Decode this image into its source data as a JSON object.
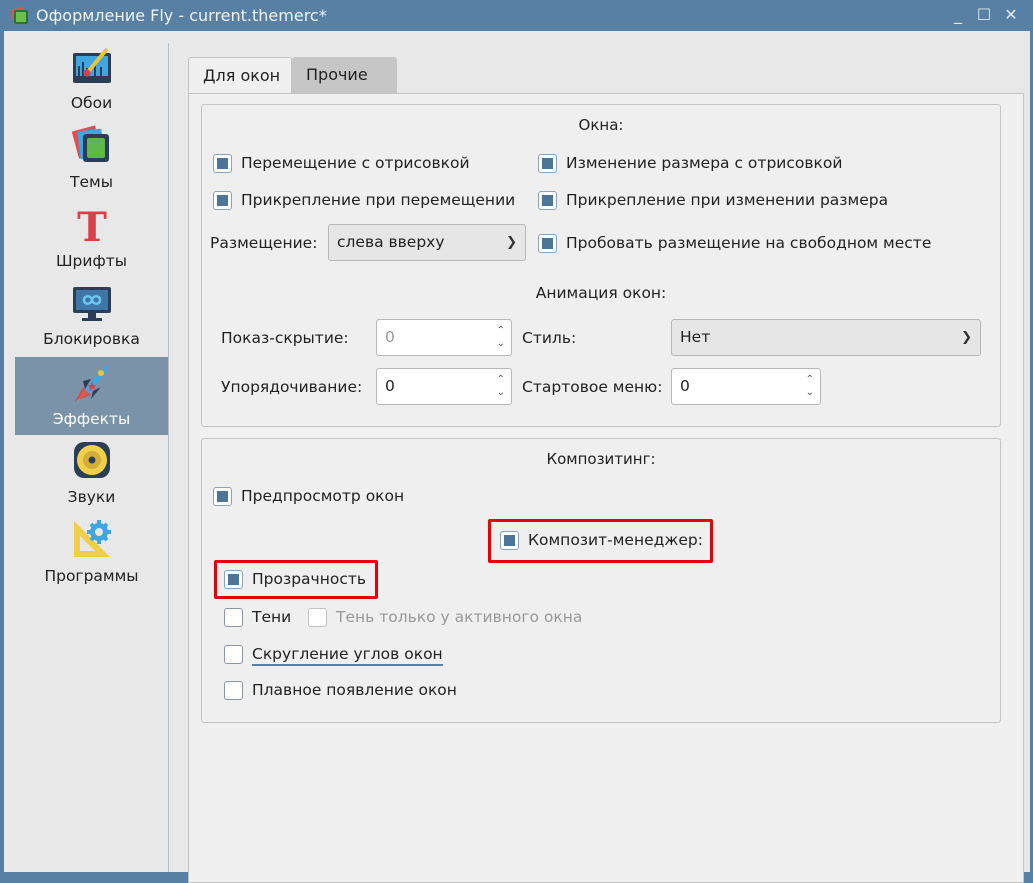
{
  "window": {
    "title": "Оформление Fly - current.themerc*",
    "controls": {
      "minimize": "_",
      "maximize": "☐",
      "close": "✕"
    }
  },
  "sidebar": {
    "items": [
      {
        "label": "Обои",
        "icon": "wallpaper-icon"
      },
      {
        "label": "Темы",
        "icon": "themes-icon"
      },
      {
        "label": "Шрифты",
        "icon": "fonts-icon"
      },
      {
        "label": "Блокировка",
        "icon": "lock-screen-icon"
      },
      {
        "label": "Эффекты",
        "icon": "rocket-icon",
        "selected": true
      },
      {
        "label": "Звуки",
        "icon": "speaker-icon"
      },
      {
        "label": "Программы",
        "icon": "programs-icon"
      }
    ]
  },
  "tabs": [
    {
      "label": "Для окон",
      "active": true
    },
    {
      "label": "Прочие",
      "active": false
    }
  ],
  "windows_group": {
    "title": "Окна:",
    "move_opaque": {
      "label": "Перемещение с отрисовкой",
      "checked": true
    },
    "resize_opaque": {
      "label": "Изменение размера с отрисовкой",
      "checked": true
    },
    "snap_move": {
      "label": "Прикрепление при перемещении",
      "checked": true
    },
    "snap_resize": {
      "label": "Прикрепление при изменении размера",
      "checked": true
    },
    "placement_label": "Размещение:",
    "placement_value": "слева вверху",
    "smart_placement": {
      "label": "Пробовать размещение на свободном месте",
      "checked": true
    },
    "animation_title": "Анимация окон:",
    "show_hide_label": "Показ-скрытие:",
    "show_hide_value": "0",
    "style_label": "Стиль:",
    "style_value": "Нет",
    "arrange_label": "Упорядочивание:",
    "arrange_value": "0",
    "start_menu_label": "Стартовое меню:",
    "start_menu_value": "0"
  },
  "compositing_group": {
    "title": "Композитинг:",
    "preview": {
      "label": "Предпросмотр окон",
      "checked": true
    },
    "composite_manager": {
      "label": "Композит-менеджер:",
      "checked": true
    },
    "transparency": {
      "label": "Прозрачность",
      "checked": true
    },
    "shadows": {
      "label": "Тени",
      "checked": false
    },
    "shadow_active_only": {
      "label": "Тень только у активного окна",
      "checked": false,
      "disabled": true
    },
    "rounded_corners": {
      "label": "Скругление углов окон",
      "checked": false
    },
    "fade_in": {
      "label": "Плавное появление окон",
      "checked": false
    }
  },
  "colors": {
    "titlebar": "#5780a4",
    "selected": "#7b93a9",
    "check": "#4d7598",
    "highlight": "#e8000b"
  }
}
